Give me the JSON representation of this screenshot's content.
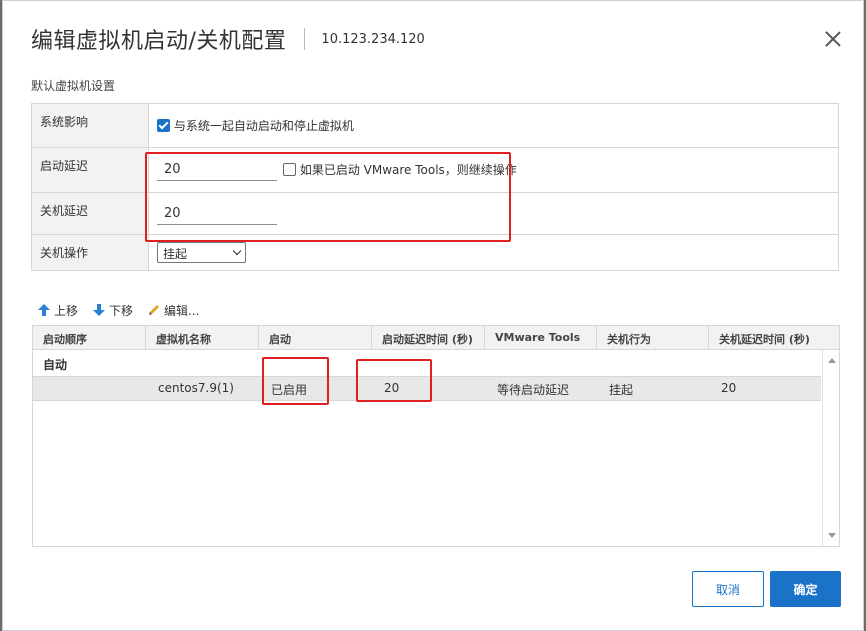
{
  "dialog": {
    "title": "编辑虚拟机启动/关机配置",
    "host": "10.123.234.120"
  },
  "defaults": {
    "section_title": "默认虚拟机设置",
    "system_impact": {
      "label": "系统影响",
      "checkbox_checked": true,
      "checkbox_label": "与系统一起自动启动和停止虚拟机"
    },
    "startup_delay": {
      "label": "启动延迟",
      "value": "20",
      "checkbox_checked": false,
      "checkbox_label": "如果已启动 VMware Tools，则继续操作"
    },
    "shutdown_delay": {
      "label": "关机延迟",
      "value": "20"
    },
    "shutdown_action": {
      "label": "关机操作",
      "selected": "挂起"
    }
  },
  "toolbar": {
    "move_up": "上移",
    "move_down": "下移",
    "edit": "编辑..."
  },
  "table": {
    "columns": [
      "启动顺序",
      "虚拟机名称",
      "启动",
      "启动延迟时间 (秒)",
      "VMware Tools",
      "关机行为",
      "关机延迟时间 (秒)"
    ],
    "group": "自动",
    "rows": [
      {
        "order": "",
        "name": "centos7.9(1)",
        "startup": "已启用",
        "startup_delay": "20",
        "vmware_tools": "等待启动延迟",
        "shutdown_action": "挂起",
        "shutdown_delay": "20"
      }
    ]
  },
  "buttons": {
    "cancel": "取消",
    "ok": "确定"
  },
  "colors": {
    "accent": "#1a73c9",
    "highlight": "#e02020"
  }
}
